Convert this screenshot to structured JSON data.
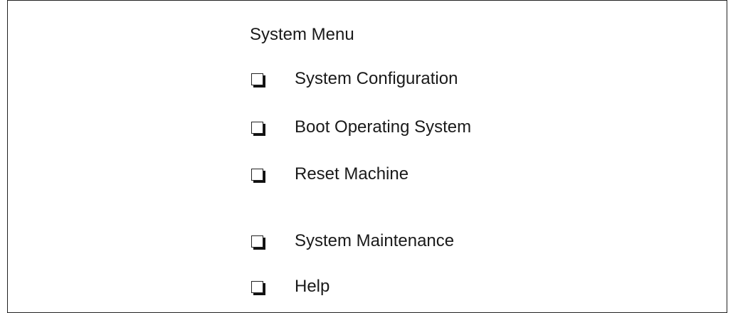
{
  "menu": {
    "title": "System Menu",
    "items": [
      {
        "label": "System Configuration",
        "icon": "checkbox-icon",
        "checked": false
      },
      {
        "label": "Boot Operating System",
        "icon": "checkbox-icon",
        "checked": false
      },
      {
        "label": "Reset Machine",
        "icon": "checkbox-icon",
        "checked": false
      },
      {
        "label": "System Maintenance",
        "icon": "checkbox-icon",
        "checked": false
      },
      {
        "label": "Help",
        "icon": "checkbox-icon",
        "checked": false
      }
    ]
  },
  "colors": {
    "background": "#ffffff",
    "border": "#222222",
    "text": "#1a1a1a"
  }
}
